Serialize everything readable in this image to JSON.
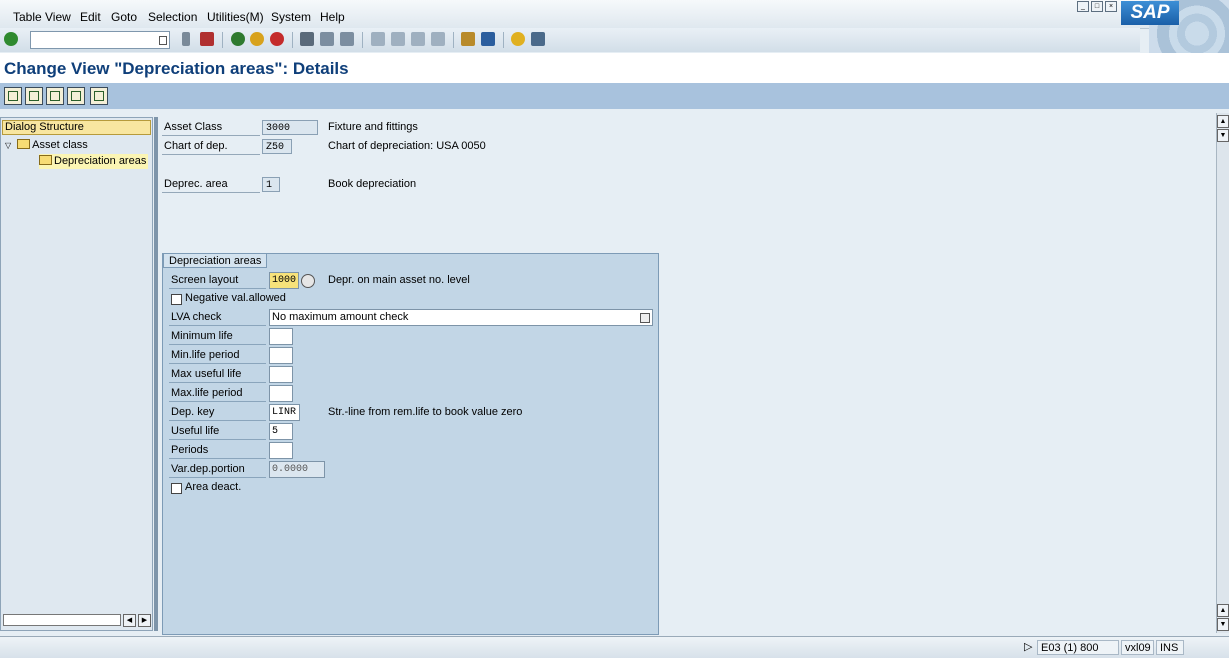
{
  "menu": {
    "items": [
      "Table View",
      "Edit",
      "Goto",
      "Selection",
      "Utilities(M)",
      "System",
      "Help"
    ],
    "logo": "SAP"
  },
  "title": "Change View \"Depreciation areas\": Details",
  "dialog_structure": {
    "title": "Dialog Structure",
    "items": [
      "Asset class",
      "Depreciation areas"
    ]
  },
  "header_fields": {
    "asset_class": {
      "label": "Asset Class",
      "value": "3000",
      "desc": "Fixture and fittings"
    },
    "chart_of_dep": {
      "label": "Chart of dep.",
      "value": "Z50",
      "desc": "Chart of depreciation: USA 0050"
    },
    "deprec_area": {
      "label": "Deprec. area",
      "value": "1",
      "desc": "Book depreciation"
    }
  },
  "group": {
    "title": "Depreciation areas",
    "screen_layout": {
      "label": "Screen layout",
      "value": "1000",
      "desc": "Depr. on main asset no. level"
    },
    "negative_val": {
      "label": "Negative val.allowed"
    },
    "lva_check": {
      "label": "LVA check",
      "value": "No maximum amount check"
    },
    "minimum_life": {
      "label": "Minimum life",
      "value": ""
    },
    "min_life_period": {
      "label": "Min.life period",
      "value": ""
    },
    "max_useful_life": {
      "label": "Max useful life",
      "value": ""
    },
    "max_life_period": {
      "label": "Max.life period",
      "value": ""
    },
    "dep_key": {
      "label": "Dep. key",
      "value": "LINR",
      "desc": "Str.-line from rem.life to book value zero"
    },
    "useful_life": {
      "label": "Useful life",
      "value": "5"
    },
    "periods": {
      "label": "Periods",
      "value": ""
    },
    "var_dep_portion": {
      "label": "Var.dep.portion",
      "value": "0.0000"
    },
    "area_deact": {
      "label": "Area deact."
    }
  },
  "status": {
    "system": "E03 (1) 800",
    "server": "vxl09",
    "mode": "INS"
  },
  "colors": {
    "title": "#0f3f7a",
    "app_toolbar": "#a8c2dd",
    "group_bg": "#c2d6e6"
  }
}
